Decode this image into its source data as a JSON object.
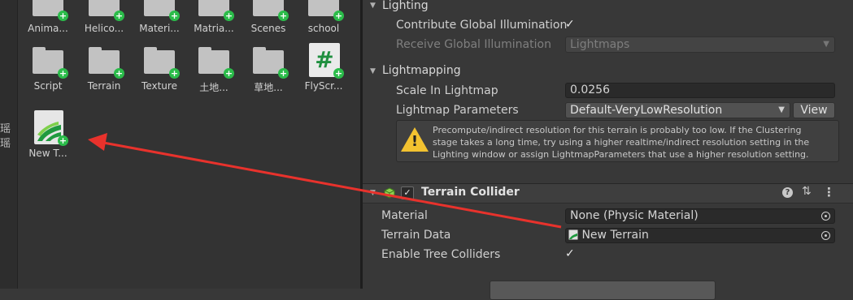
{
  "left_strip": {
    "chars": [
      "瑶",
      "瑶"
    ]
  },
  "project_assets": {
    "row1": [
      "Anima...",
      "Helico...",
      "Materi...",
      "Matria...",
      "Scenes",
      "school"
    ],
    "row2": [
      "Script",
      "Terrain",
      "Texture",
      "土地...",
      "草地...",
      "FlyScr..."
    ],
    "row3": [
      "New T..."
    ],
    "script_glyph": "#",
    "plus_glyph": "+"
  },
  "inspector": {
    "lighting": {
      "header": "Lighting",
      "contribute_gi_label": "Contribute Global Illumination",
      "contribute_gi_checked": true,
      "receive_gi_label": "Receive Global Illumination",
      "receive_gi_value": "Lightmaps"
    },
    "lightmapping": {
      "header": "Lightmapping",
      "scale_label": "Scale In Lightmap",
      "scale_value": "0.0256",
      "params_label": "Lightmap Parameters",
      "params_value": "Default-VeryLowResolution",
      "view_button": "View",
      "warning_line1": "Precompute/indirect resolution for this terrain is probably too low. If the Clustering",
      "warning_line2": "stage takes a long time, try using a higher realtime/indirect resolution setting in the",
      "warning_line3": "Lighting window or assign LightmapParameters that use a higher resolution setting.",
      "warning_mark": "!"
    },
    "terrain_collider": {
      "title": "Terrain Collider",
      "enabled": true,
      "material_label": "Material",
      "material_value": "None (Physic Material)",
      "terrain_data_label": "Terrain Data",
      "terrain_data_value": "New Terrain",
      "tree_colliders_label": "Enable Tree Colliders",
      "tree_colliders_checked": true,
      "help_glyph": "?",
      "presets_glyph": "⇅",
      "menu_glyph": "⋮"
    },
    "check_glyph": "✓",
    "foldout_glyph": "▼",
    "caret_glyph": "▼"
  },
  "colors": {
    "arrow": "#e8322c",
    "accent_green": "#2bbc4a",
    "warning": "#f2c230"
  }
}
